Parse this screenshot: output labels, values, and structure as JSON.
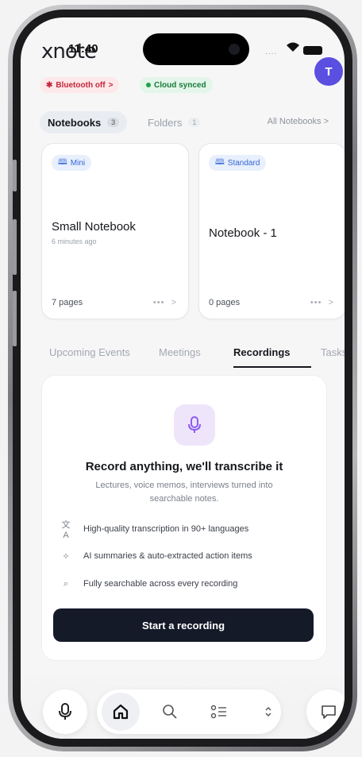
{
  "app": {
    "logo_text": "xnote"
  },
  "status_bar": {
    "time": "11:40",
    "signal_dots": "....",
    "wifi_glyph": "▾"
  },
  "avatar": {
    "initial": "T",
    "color": "#5a4fe0"
  },
  "status_chips": {
    "bluetooth": {
      "label": "Bluetooth off",
      "chevron": ">"
    },
    "cloud": {
      "label": "Cloud synced"
    }
  },
  "notebook_tabs": {
    "notebooks": {
      "label": "Notebooks",
      "count": "3"
    },
    "folders": {
      "label": "Folders",
      "count": "1"
    },
    "all_link": "All Notebooks >"
  },
  "notebooks": [
    {
      "type": "Mini",
      "title": "Small Notebook",
      "subtitle": "6 minutes ago",
      "pages": "7 pages",
      "more": "•••",
      "chevron": ">"
    },
    {
      "type": "Standard",
      "title": "Notebook - 1",
      "subtitle": "",
      "pages": "0 pages",
      "more": "•••",
      "chevron": ">"
    }
  ],
  "main_tabs": [
    {
      "label": "Upcoming Events",
      "active": false
    },
    {
      "label": "Meetings",
      "active": false
    },
    {
      "label": "Recordings",
      "active": true
    },
    {
      "label": "Tasks",
      "active": false
    }
  ],
  "recordings": {
    "title": "Record anything, we'll transcribe it",
    "description": "Lectures, voice memos, interviews turned into searchable notes.",
    "features": [
      {
        "icon": "translate-icon",
        "glyph": "文A",
        "text": "High-quality transcription in 90+ languages"
      },
      {
        "icon": "sparkles-icon",
        "glyph": "✧",
        "text": "AI summaries & auto-extracted action items"
      },
      {
        "icon": "search-icon",
        "glyph": "⌕",
        "text": "Fully searchable across every recording"
      }
    ],
    "cta": "Start a recording"
  },
  "bottom_nav": {
    "items": [
      "microphone-icon",
      "home-icon",
      "search-icon",
      "list-icon",
      "expand-icon",
      "chat-icon"
    ]
  },
  "colors": {
    "accent_purple": "#5a4fe0",
    "cta_dark": "#141a28",
    "bluetooth_red": "#c2273a",
    "cloud_green": "#187a3a",
    "badge_blue": "#3568d4"
  }
}
